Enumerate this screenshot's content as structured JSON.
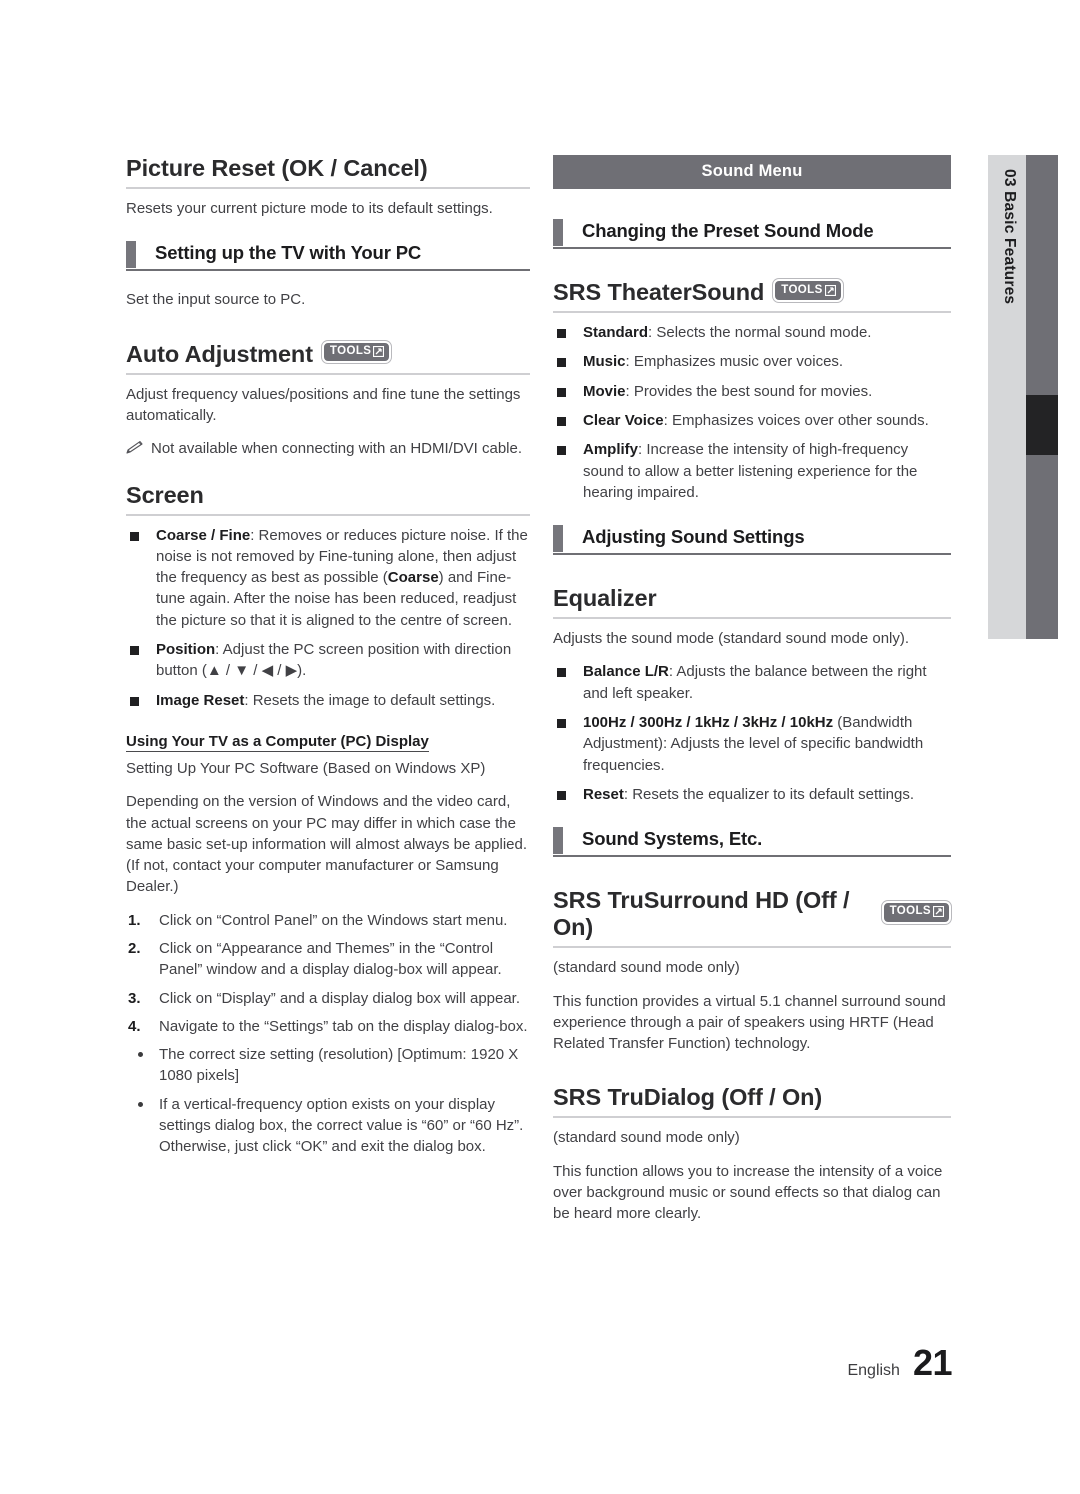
{
  "page": {
    "language": "English",
    "number": "21"
  },
  "sidebar": {
    "chapter_number": "03",
    "chapter_title": "Basic Features",
    "label_combined": "03   Basic Features"
  },
  "left_column": {
    "picture_reset": {
      "title": "Picture Reset (OK / Cancel)",
      "body": "Resets your current picture mode to its default settings."
    },
    "setting_up_tv": {
      "section_title": "Setting up the TV with Your PC",
      "body": "Set the input source to PC."
    },
    "auto_adjustment": {
      "title": "Auto Adjustment",
      "tools_label": "TOOLS",
      "body": "Adjust frequency values/positions and fine tune the settings automatically.",
      "note": "Not available when connecting with an HDMI/DVI cable."
    },
    "screen": {
      "title": "Screen",
      "items": [
        {
          "term": "Coarse / Fine",
          "text": ": Removes or reduces picture noise. If the noise is not removed by Fine-tuning alone, then adjust the frequency as best as possible (",
          "term2": "Coarse",
          "text2": ") and Fine-tune again. After the noise has been reduced, readjust the picture so that it is aligned to the centre of screen."
        },
        {
          "term": "Position",
          "text": ": Adjust the PC screen position with direction button (▲ / ▼ / ◀ / ▶)."
        },
        {
          "term": "Image Reset",
          "text": ": Resets the image to default settings."
        }
      ]
    },
    "pc_display": {
      "heading": "Using Your TV as a Computer (PC) Display",
      "para1": "Setting Up Your PC Software (Based on Windows XP)",
      "para2": "Depending on the version of Windows and the video card, the actual screens on your PC may differ in which case the same basic set-up information will almost always be applied. (If not, contact your computer manufacturer or Samsung Dealer.)",
      "steps": [
        "Click on “Control Panel” on the Windows start menu.",
        "Click on “Appearance and Themes” in the “Control Panel” window and a display dialog-box will appear.",
        "Click on “Display” and a display dialog box will appear.",
        "Navigate to the “Settings” tab on the display dialog-box."
      ],
      "bullets": [
        "The correct size setting (resolution) [Optimum: 1920 X 1080 pixels]",
        "If a vertical-frequency option exists on your display settings dialog box, the correct value is “60” or “60 Hz”. Otherwise, just click “OK” and exit the dialog box."
      ]
    }
  },
  "right_column": {
    "menu_banner": "Sound Menu",
    "changing_preset": {
      "section_title": "Changing the Preset Sound Mode"
    },
    "srs_theatersound": {
      "title": "SRS TheaterSound",
      "tools_label": "TOOLS",
      "items": [
        {
          "term": "Standard",
          "text": ": Selects the normal sound mode."
        },
        {
          "term": "Music",
          "text": ": Emphasizes music over voices."
        },
        {
          "term": "Movie",
          "text": ": Provides the best sound for movies."
        },
        {
          "term": "Clear Voice",
          "text": ": Emphasizes voices over other sounds."
        },
        {
          "term": "Amplify",
          "text": ": Increase the intensity of high-frequency sound to allow a better listening experience for the hearing impaired."
        }
      ]
    },
    "adjusting_sound": {
      "section_title": "Adjusting Sound Settings"
    },
    "equalizer": {
      "title": "Equalizer",
      "body": "Adjusts the sound mode (standard sound mode only).",
      "items": [
        {
          "term": "Balance L/R",
          "text": ": Adjusts the balance between the right and left speaker."
        },
        {
          "term": "100Hz / 300Hz / 1kHz / 3kHz / 10kHz",
          "text": " (Bandwidth Adjustment): Adjusts the level of specific bandwidth frequencies."
        },
        {
          "term": "Reset",
          "text": ": Resets the equalizer to its default settings."
        }
      ]
    },
    "sound_systems": {
      "section_title": "Sound Systems, Etc."
    },
    "srs_trusurround": {
      "title": "SRS TruSurround HD (Off / On)",
      "tools_label": "TOOLS",
      "note": "(standard sound mode only)",
      "body": "This function provides a virtual 5.1 channel surround sound experience through a pair of speakers using HRTF (Head Related Transfer Function) technology."
    },
    "srs_trudialog": {
      "title": "SRS TruDialog (Off / On)",
      "note": "(standard sound mode only)",
      "body": "This function allows you to increase the intensity of a voice over background music or sound effects so that dialog can be heard more clearly."
    }
  },
  "colors": {
    "bar_gray": "#6f6f75",
    "sidebar_light": "#d6d7d9",
    "sidebar_active": "#232325",
    "rule_gray": "#cfcfd2",
    "text": "#414145"
  }
}
